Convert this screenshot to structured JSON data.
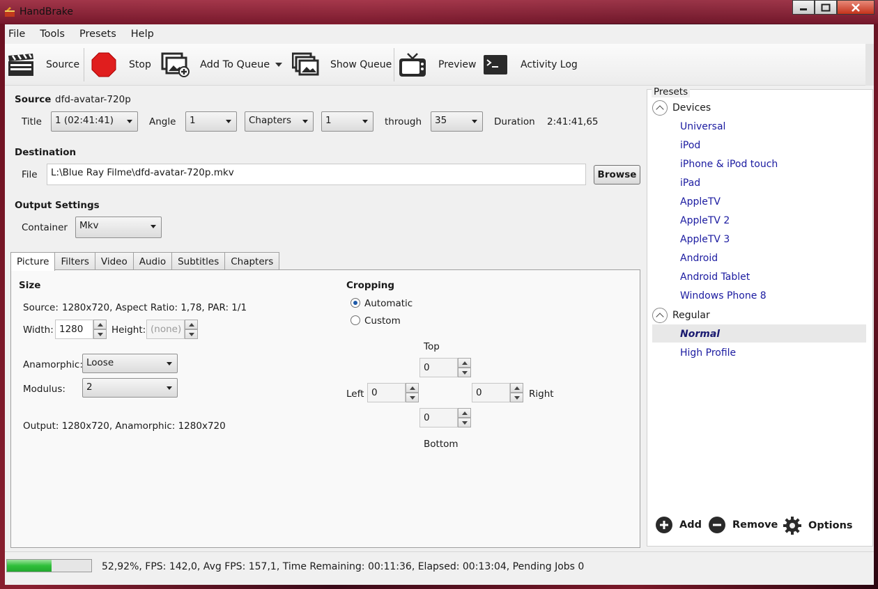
{
  "window": {
    "title": "HandBrake"
  },
  "menu": [
    "File",
    "Tools",
    "Presets",
    "Help"
  ],
  "toolbar": {
    "source": "Source",
    "stop": "Stop",
    "add_to_queue": "Add To Queue",
    "show_queue": "Show Queue",
    "preview": "Preview",
    "activity_log": "Activity Log"
  },
  "source": {
    "heading": "Source",
    "name": "dfd-avatar-720p",
    "title_label": "Title",
    "title_value": "1 (02:41:41)",
    "angle_label": "Angle",
    "angle_value": "1",
    "range_type": "Chapters",
    "range_start": "1",
    "through_label": "through",
    "range_end": "35",
    "duration_label": "Duration",
    "duration_value": "2:41:41,65"
  },
  "destination": {
    "heading": "Destination",
    "file_label": "File",
    "file_value": "L:\\Blue Ray Filme\\dfd-avatar-720p.mkv",
    "browse": "Browse"
  },
  "output": {
    "heading": "Output Settings",
    "container_label": "Container",
    "container_value": "Mkv"
  },
  "tabs": [
    "Picture",
    "Filters",
    "Video",
    "Audio",
    "Subtitles",
    "Chapters"
  ],
  "picture": {
    "size_heading": "Size",
    "source_label": "Source:",
    "source_value": "1280x720, Aspect Ratio: 1,78, PAR: 1/1",
    "width_label": "Width:",
    "width_value": "1280",
    "height_label": "Height:",
    "height_value": "(none)",
    "anamorphic_label": "Anamorphic:",
    "anamorphic_value": "Loose",
    "modulus_label": "Modulus:",
    "modulus_value": "2",
    "output_text": "Output: 1280x720, Anamorphic: 1280x720",
    "cropping_heading": "Cropping",
    "automatic": "Automatic",
    "custom": "Custom",
    "top_label": "Top",
    "top_value": "0",
    "left_label": "Left",
    "left_value": "0",
    "right_label": "Right",
    "right_value": "0",
    "bottom_label": "Bottom",
    "bottom_value": "0"
  },
  "presets": {
    "heading": "Presets",
    "groups": [
      {
        "name": "Devices",
        "items": [
          "Universal",
          "iPod",
          "iPhone & iPod touch",
          "iPad",
          "AppleTV",
          "AppleTV 2",
          "AppleTV 3",
          "Android",
          "Android Tablet",
          "Windows Phone 8"
        ]
      },
      {
        "name": "Regular",
        "items": [
          "Normal",
          "High Profile"
        ]
      }
    ],
    "selected": "Normal",
    "add": "Add",
    "remove": "Remove",
    "options": "Options"
  },
  "status": {
    "progress_percent": 52.92,
    "text": "52,92%,  FPS: 142,0,  Avg FPS: 157,1,  Time Remaining: 00:11:36,  Elapsed: 00:13:04,  Pending Jobs 0"
  },
  "colors": {
    "accent": "#1e5aa8",
    "preset_link": "#1a1aa0",
    "progress": "#2fbf3a"
  }
}
